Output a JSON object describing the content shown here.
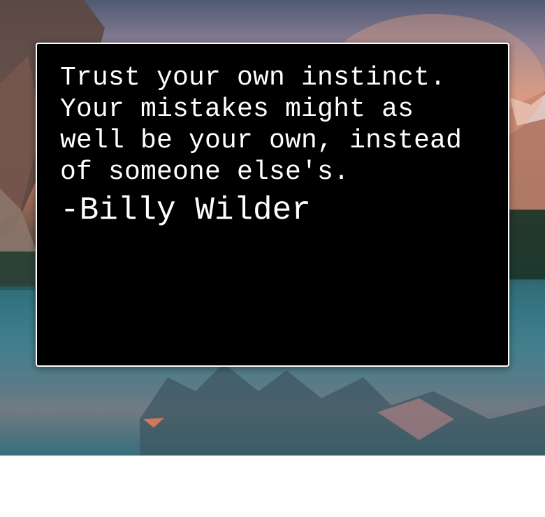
{
  "background": {
    "image": "mountain-lake-sunset-photo",
    "colors": {
      "sky": "#c79487",
      "water": "#3d7f8b",
      "mountain": "#6b5247"
    }
  },
  "quote": {
    "text": "Trust your own instinct. Your mistakes might as well be your own, instead of someone else's.",
    "author": "-Billy Wilder"
  },
  "colors": {
    "box_background": "#000000",
    "box_border": "#ffffff",
    "text": "#ffffff"
  }
}
